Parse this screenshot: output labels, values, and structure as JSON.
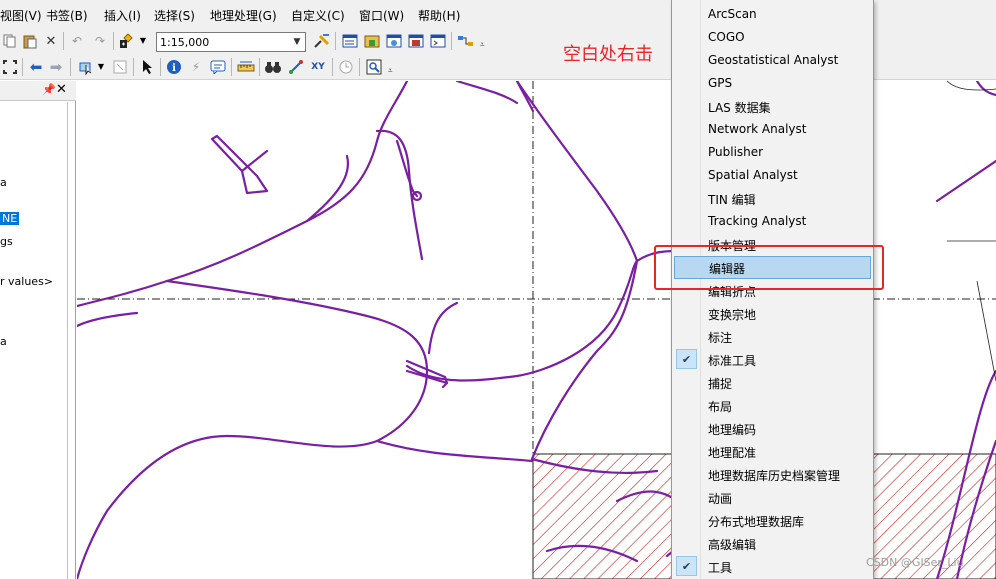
{
  "menubar": {
    "items": [
      "视图(V)",
      "书签(B)",
      "插入(I)",
      "选择(S)",
      "地理处理(G)",
      "自定义(C)",
      "窗口(W)",
      "帮助(H)"
    ]
  },
  "toolbar": {
    "scale_value": "1:15,000",
    "row1_icons": [
      "copy-icon",
      "paste-icon",
      "delete-icon",
      "undo-icon",
      "redo-icon",
      "add-data-icon",
      "scale-combo",
      "editor-toolbar-icon",
      "table-of-contents-icon",
      "catalog-icon",
      "search-window-icon",
      "arctoolbox-icon",
      "python-window-icon",
      "model-builder-icon"
    ],
    "row2_icons": [
      "full-extent-icon",
      "back-icon",
      "forward-icon",
      "select-features-icon",
      "clear-selection-icon",
      "select-elements-icon",
      "identify-icon",
      "html-popup-icon",
      "find-icon",
      "measure-icon",
      "binoculars-icon",
      "go-to-xy-icon",
      "time-slider-icon",
      "create-viewer-icon"
    ]
  },
  "annotation": {
    "text": "空白处右击",
    "color": "#e8262a"
  },
  "toc": {
    "lines": [
      "a",
      "NE",
      "gs",
      "r values>",
      "a"
    ]
  },
  "context_menu": {
    "items": [
      {
        "label": "ArcScan",
        "checked": false,
        "highlighted": false
      },
      {
        "label": "COGO",
        "checked": false,
        "highlighted": false
      },
      {
        "label": "Geostatistical Analyst",
        "checked": false,
        "highlighted": false
      },
      {
        "label": "GPS",
        "checked": false,
        "highlighted": false
      },
      {
        "label": "LAS 数据集",
        "checked": false,
        "highlighted": false
      },
      {
        "label": "Network Analyst",
        "checked": false,
        "highlighted": false
      },
      {
        "label": "Publisher",
        "checked": false,
        "highlighted": false
      },
      {
        "label": "Spatial Analyst",
        "checked": false,
        "highlighted": false
      },
      {
        "label": "TIN 编辑",
        "checked": false,
        "highlighted": false
      },
      {
        "label": "Tracking Analyst",
        "checked": false,
        "highlighted": false
      },
      {
        "label": "版本管理",
        "checked": false,
        "highlighted": false
      },
      {
        "label": "编辑器",
        "checked": false,
        "highlighted": true
      },
      {
        "label": "编辑折点",
        "checked": false,
        "highlighted": false
      },
      {
        "label": "变换宗地",
        "checked": false,
        "highlighted": false
      },
      {
        "label": "标注",
        "checked": false,
        "highlighted": false
      },
      {
        "label": "标准工具",
        "checked": true,
        "highlighted": false
      },
      {
        "label": "捕捉",
        "checked": false,
        "highlighted": false
      },
      {
        "label": "布局",
        "checked": false,
        "highlighted": false
      },
      {
        "label": "地理编码",
        "checked": false,
        "highlighted": false
      },
      {
        "label": "地理配准",
        "checked": false,
        "highlighted": false
      },
      {
        "label": "地理数据库历史档案管理",
        "checked": false,
        "highlighted": false
      },
      {
        "label": "动画",
        "checked": false,
        "highlighted": false
      },
      {
        "label": "分布式地理数据库",
        "checked": false,
        "highlighted": false
      },
      {
        "label": "高级编辑",
        "checked": false,
        "highlighted": false
      },
      {
        "label": "工具",
        "checked": true,
        "highlighted": false
      }
    ],
    "check_glyph": "✔"
  },
  "map": {
    "road_color": "#7b1fa2",
    "hatch_color": "#d32f2f"
  },
  "watermark": {
    "text": "CSDN @GISer_Liu"
  }
}
